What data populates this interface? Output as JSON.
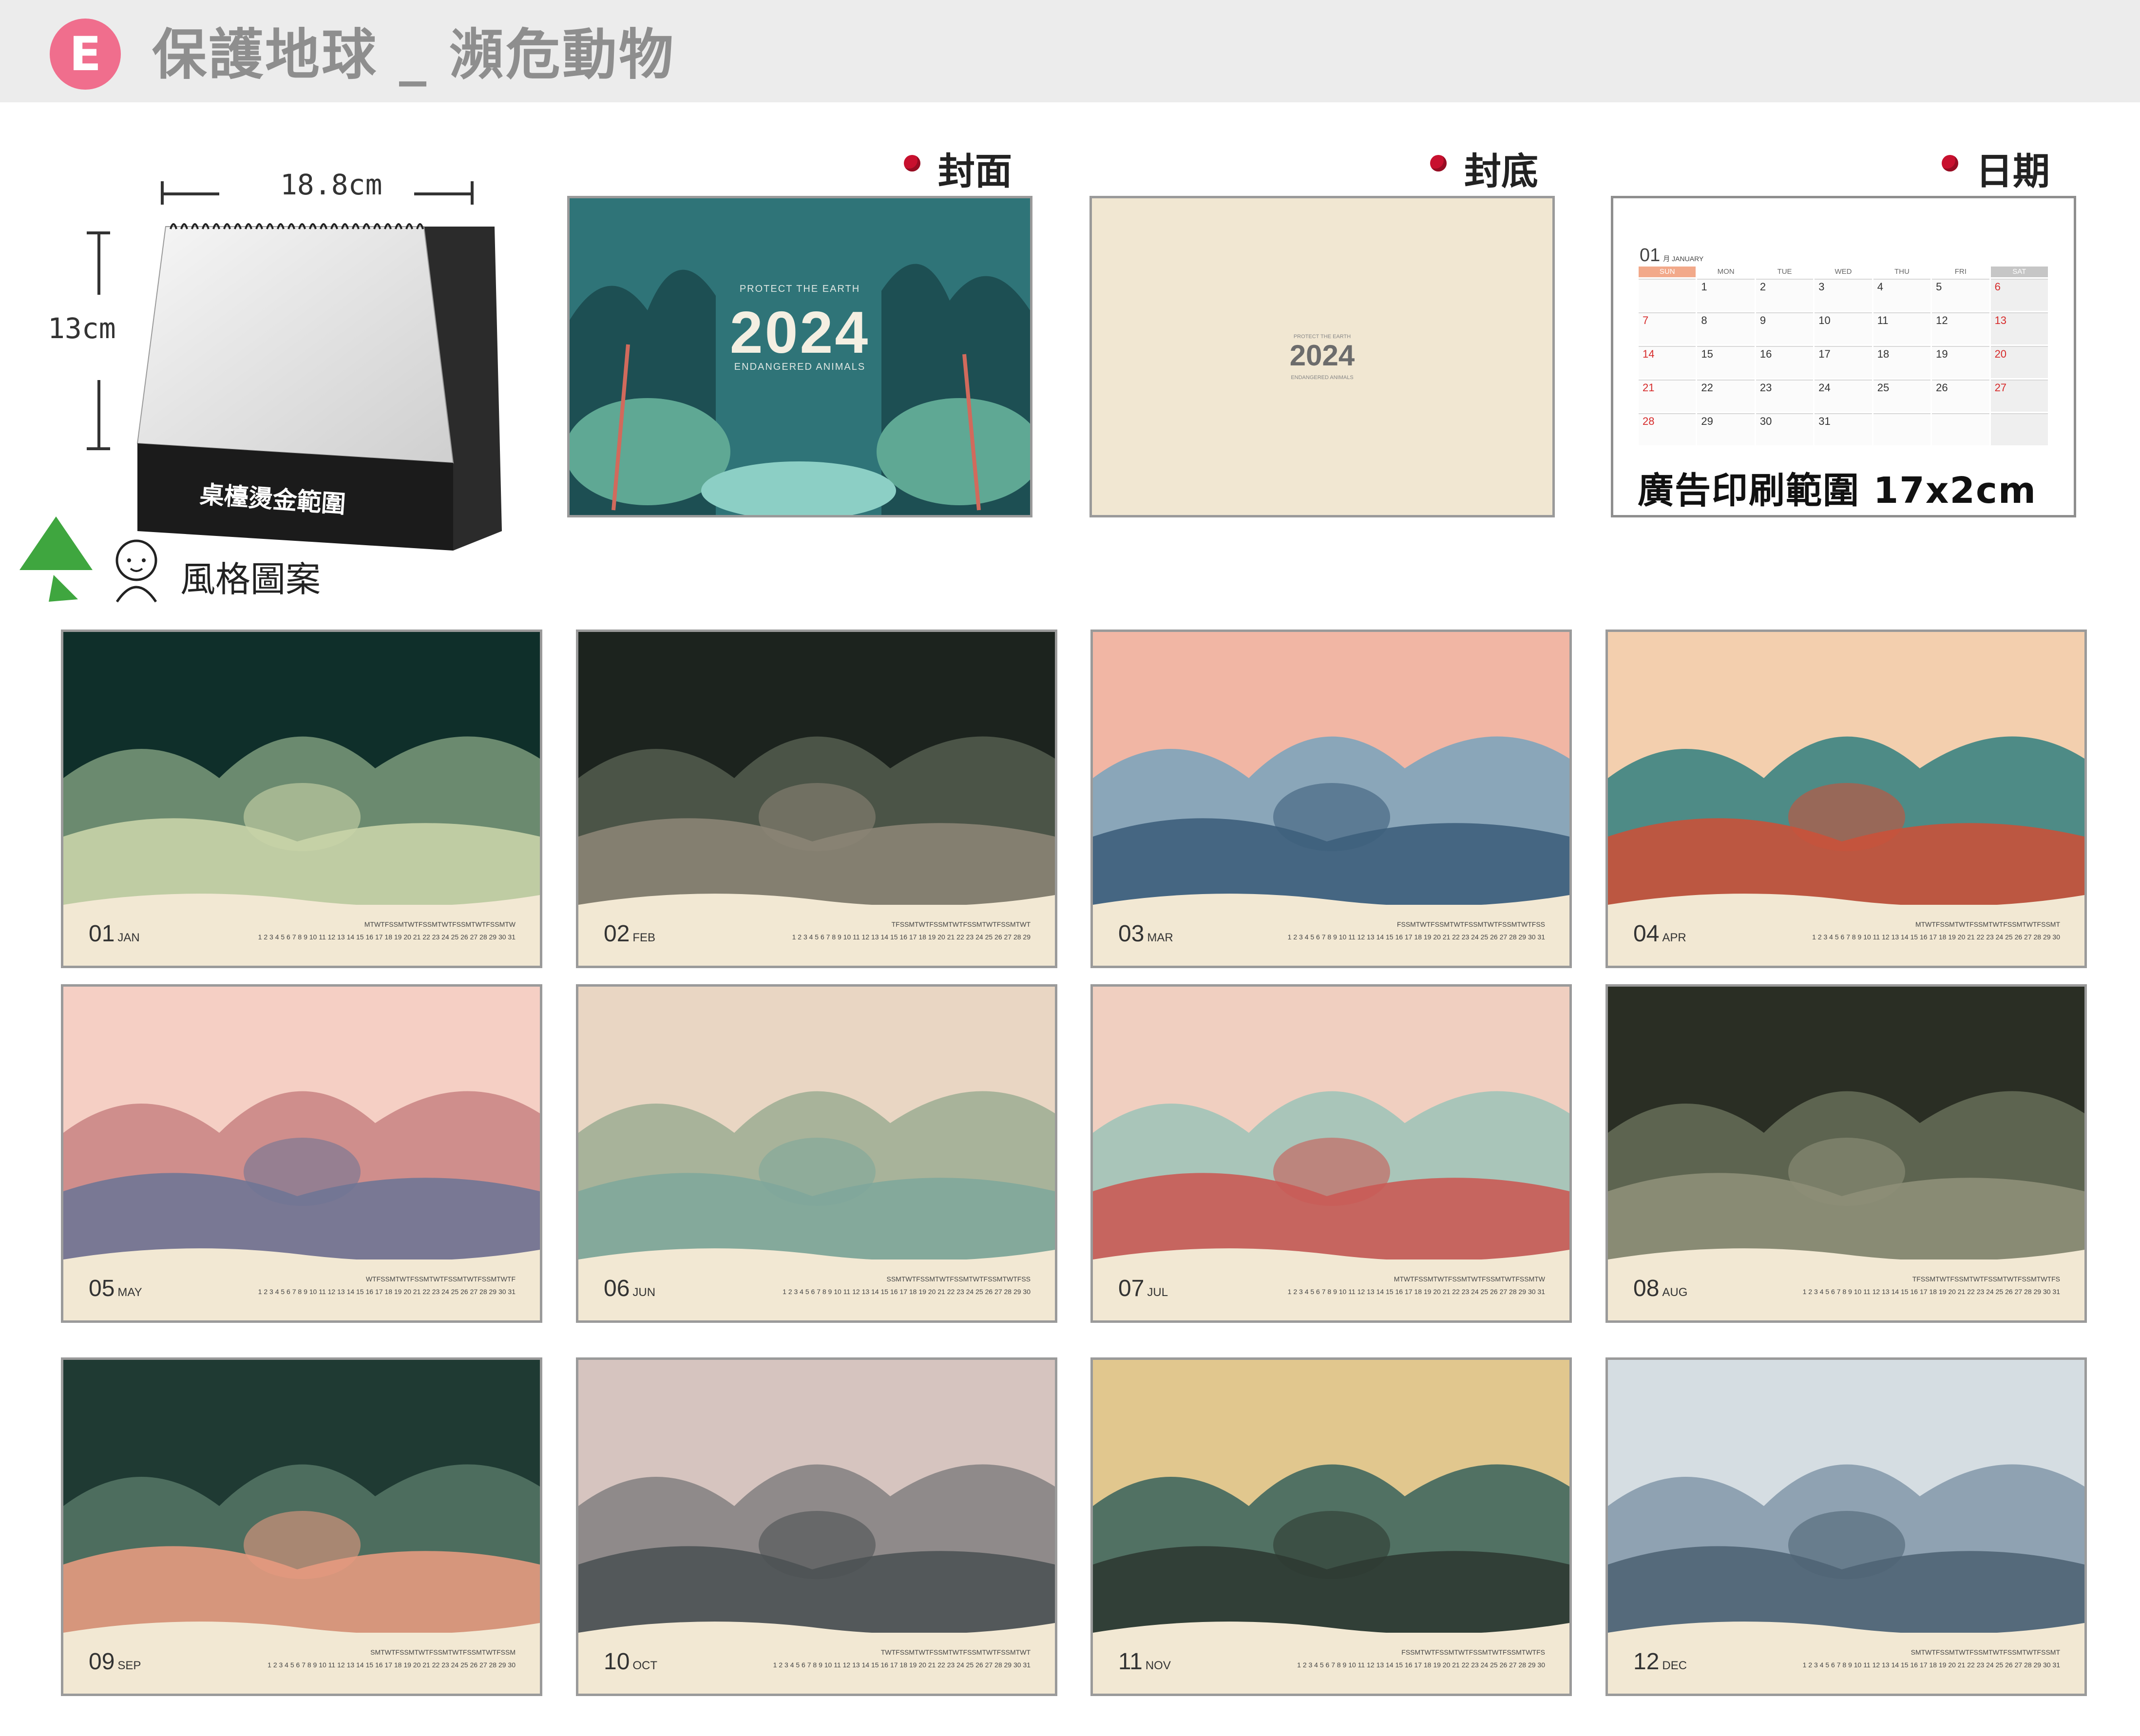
{
  "header": {
    "badge": "E",
    "title": "保護地球 _ 瀕危動物"
  },
  "desk_calendar": {
    "width_label": "18.8cm",
    "height_label": "13cm",
    "base_label": "桌檯燙金範圍",
    "style_label": "風格圖案"
  },
  "sections": {
    "cover_label": "封面",
    "back_label": "封底",
    "date_label": "日期"
  },
  "cover": {
    "top_text": "PROTECT THE EARTH",
    "year": "2024",
    "bottom_text": "ENDANGERED ANIMALS"
  },
  "back": {
    "top_text": "PROTECT THE EARTH",
    "year": "2024",
    "bottom_text": "ENDANGERED ANIMALS"
  },
  "date_page": {
    "month_number": "01",
    "month_name": "月 JANUARY",
    "weekdays": [
      "SUN",
      "MON",
      "TUE",
      "WED",
      "THU",
      "FRI",
      "SAT"
    ],
    "weeks": [
      [
        "",
        "1",
        "2",
        "3",
        "4",
        "5",
        "6"
      ],
      [
        "7",
        "8",
        "9",
        "10",
        "11",
        "12",
        "13"
      ],
      [
        "14",
        "15",
        "16",
        "17",
        "18",
        "19",
        "20"
      ],
      [
        "21",
        "22",
        "23",
        "24",
        "25",
        "26",
        "27"
      ],
      [
        "28",
        "29",
        "30",
        "31",
        "",
        "",
        ""
      ]
    ],
    "ad_text": "廣告印刷範圍 17x2cm"
  },
  "months": [
    {
      "num": "01",
      "abbr": "JAN",
      "letters": "MTWTFSSMTWTFSSMTWTFSSMTWTFSSMTW",
      "days": "1 2 3 4 5 6 7 8 9 10 11 12 13 14 15 16 17 18 19 20 21 22 23 24 25 26 27 28 29 30 31",
      "colors": [
        "#0f2f2a",
        "#6b8a6f",
        "#c9d3a8"
      ]
    },
    {
      "num": "02",
      "abbr": "FEB",
      "letters": "TFSSMTWTFSSMTWTFSSMTWTFSSMTWT",
      "days": "1 2 3 4 5 6 7 8 9 10 11 12 13 14 15 16 17 18 19 20 21 22 23 24 25 26 27 28 29",
      "colors": [
        "#1c231e",
        "#4b5447",
        "#8b8474"
      ]
    },
    {
      "num": "03",
      "abbr": "MAR",
      "letters": "FSSMTWTFSSMTWTFSSMTWTFSSMTWTFSS",
      "days": "1 2 3 4 5 6 7 8 9 10 11 12 13 14 15 16 17 18 19 20 21 22 23 24 25 26 27 28 29 30 31",
      "colors": [
        "#f1b6a4",
        "#8aa6b9",
        "#3d5f7c"
      ]
    },
    {
      "num": "04",
      "abbr": "APR",
      "letters": "MTWTFSSMTWTFSSMTWTFSSMTWTFSSMT",
      "days": "1 2 3 4 5 6 7 8 9 10 11 12 13 14 15 16 17 18 19 20 21 22 23 24 25 26 27 28 29 30",
      "colors": [
        "#f3cfae",
        "#4e8b86",
        "#c9513a"
      ]
    },
    {
      "num": "05",
      "abbr": "MAY",
      "letters": "WTFSSMTWTFSSMTWTFSSMTWTFSSMTWTF",
      "days": "1 2 3 4 5 6 7 8 9 10 11 12 13 14 15 16 17 18 19 20 21 22 23 24 25 26 27 28 29 30 31",
      "colors": [
        "#f5cfc4",
        "#cf8e8c",
        "#6f7595"
      ]
    },
    {
      "num": "06",
      "abbr": "JUN",
      "letters": "SSMTWTFSSMTWTFSSMTWTFSSMTWTFSS",
      "days": "1 2 3 4 5 6 7 8 9 10 11 12 13 14 15 16 17 18 19 20 21 22 23 24 25 26 27 28 29 30",
      "colors": [
        "#e9d6c3",
        "#a8b39a",
        "#7fa79b"
      ]
    },
    {
      "num": "07",
      "abbr": "JUL",
      "letters": "MTWTFSSMTWTFSSMTWTFSSMTWTFSSMTW",
      "days": "1 2 3 4 5 6 7 8 9 10 11 12 13 14 15 16 17 18 19 20 21 22 23 24 25 26 27 28 29 30 31",
      "colors": [
        "#f0cfc0",
        "#a9c5b9",
        "#c95a55"
      ]
    },
    {
      "num": "08",
      "abbr": "AUG",
      "letters": "TFSSMTWTFSSMTWTFSSMTWTFSSMTWTFS",
      "days": "1 2 3 4 5 6 7 8 9 10 11 12 13 14 15 16 17 18 19 20 21 22 23 24 25 26 27 28 29 30 31",
      "colors": [
        "#2a2e24",
        "#5d6450",
        "#8e8f78"
      ]
    },
    {
      "num": "09",
      "abbr": "SEP",
      "letters": "SMTWTFSSMTWTFSSMTWTFSSMTWTFSSM",
      "days": "1 2 3 4 5 6 7 8 9 10 11 12 13 14 15 16 17 18 19 20 21 22 23 24 25 26 27 28 29 30",
      "colors": [
        "#1f3a33",
        "#4d6d5e",
        "#e69a80"
      ]
    },
    {
      "num": "10",
      "abbr": "OCT",
      "letters": "TWTFSSMTWTFSSMTWTFSSMTWTFSSMTWT",
      "days": "1 2 3 4 5 6 7 8 9 10 11 12 13 14 15 16 17 18 19 20 21 22 23 24 25 26 27 28 29 30 31",
      "colors": [
        "#d6c4bf",
        "#8f8a8a",
        "#4c5254"
      ]
    },
    {
      "num": "11",
      "abbr": "NOV",
      "letters": "FSSMTWTFSSMTWTFSSMTWTFSSMTWTFS",
      "days": "1 2 3 4 5 6 7 8 9 10 11 12 13 14 15 16 17 18 19 20 21 22 23 24 25 26 27 28 29 30",
      "colors": [
        "#e1c78e",
        "#517163",
        "#2e3a32"
      ]
    },
    {
      "num": "12",
      "abbr": "DEC",
      "letters": "SMTWTFSSMTWTFSSMTWTFSSMTWTFSSMT",
      "days": "1 2 3 4 5 6 7 8 9 10 11 12 13 14 15 16 17 18 19 20 21 22 23 24 25 26 27 28 29 30 31",
      "colors": [
        "#d5dde2",
        "#8fa2b2",
        "#4f6474"
      ]
    }
  ]
}
